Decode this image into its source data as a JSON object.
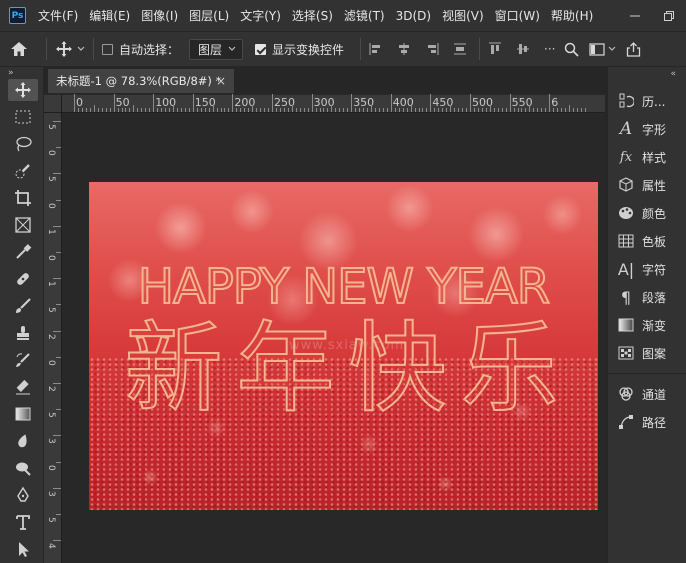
{
  "app": {
    "logo": "Ps"
  },
  "menu": [
    "文件(F)",
    "编辑(E)",
    "图像(I)",
    "图层(L)",
    "文字(Y)",
    "选择(S)",
    "滤镜(T)",
    "3D(D)",
    "视图(V)",
    "窗口(W)",
    "帮助(H)"
  ],
  "options_bar": {
    "auto_select_label": "自动选择：",
    "layer_dropdown_value": "图层",
    "show_transform_label": "显示变换控件"
  },
  "document": {
    "tab_title": "未标题-1 @ 78.3%(RGB/8#) *",
    "tab_close": "×"
  },
  "ruler": {
    "h_labels": [
      "0",
      "50",
      "100",
      "150",
      "200",
      "250",
      "300",
      "350",
      "400",
      "450",
      "500",
      "550",
      "6"
    ],
    "v_labels": [
      "5",
      "0",
      "5",
      "0",
      "1",
      "0",
      "1",
      "5",
      "2",
      "0",
      "2",
      "5",
      "3",
      "0",
      "3",
      "5",
      "4"
    ]
  },
  "canvas_content": {
    "headline": "HAPPY NEW YEAR",
    "chinese_text": "新年快乐",
    "watermark": "www.sxiaw.com"
  },
  "right_panel": {
    "items": [
      {
        "label": "历...",
        "icon": "history-icon"
      },
      {
        "label": "字形",
        "icon": "glyphs-icon"
      },
      {
        "label": "样式",
        "icon": "styles-icon"
      },
      {
        "label": "属性",
        "icon": "properties-icon"
      },
      {
        "label": "颜色",
        "icon": "color-icon"
      },
      {
        "label": "色板",
        "icon": "swatches-icon"
      },
      {
        "label": "字符",
        "icon": "character-icon"
      },
      {
        "label": "段落",
        "icon": "paragraph-icon"
      },
      {
        "label": "渐变",
        "icon": "gradient-icon"
      },
      {
        "label": "图案",
        "icon": "patterns-icon"
      }
    ],
    "items2": [
      {
        "label": "通道",
        "icon": "channels-icon"
      },
      {
        "label": "路径",
        "icon": "paths-icon"
      }
    ]
  },
  "colors": {
    "ui_background": "#323232",
    "pasteboard": "#282828",
    "text_outline": "#f3b58e",
    "canvas_red": "#d73b3b"
  }
}
